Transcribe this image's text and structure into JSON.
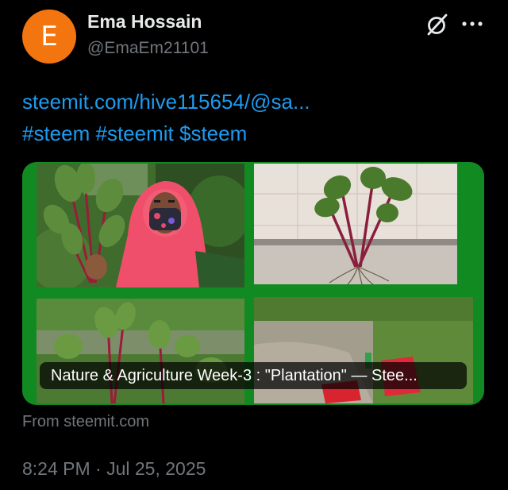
{
  "author": {
    "avatar_letter": "E",
    "avatar_color": "#f3750f",
    "display_name": "Ema Hossain",
    "handle": "@EmaEm21101"
  },
  "header": {
    "grok_icon": "grok-slash-circle-icon",
    "more_icon": "ellipsis-icon"
  },
  "tweet": {
    "link_text": "steemit.com/hive115654/@sa...",
    "hashtags": [
      "#steem",
      "#steemit",
      "$steem"
    ],
    "link_color": "#1d9bf0"
  },
  "card": {
    "title": "Nature & Agriculture Week-3 : \"Plantation\" — Stee...",
    "source": "From steemit.com",
    "frame_color": "#128a22"
  },
  "timestamp": "8:24 PM · Jul 25, 2025"
}
